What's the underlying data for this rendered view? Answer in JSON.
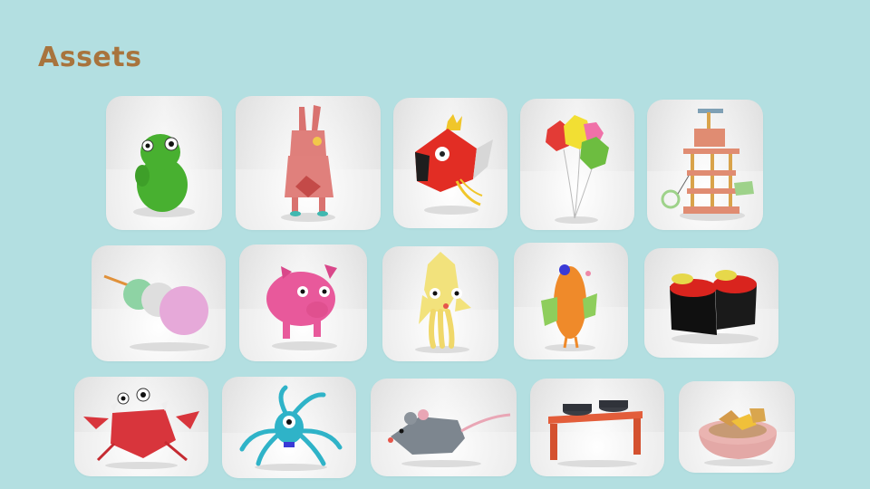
{
  "page": {
    "title": "Assets"
  },
  "assets": [
    {
      "icon": "green-creature-icon"
    },
    {
      "icon": "pink-bunny-icon"
    },
    {
      "icon": "red-fish-icon"
    },
    {
      "icon": "balloons-icon"
    },
    {
      "icon": "cat-tower-icon"
    },
    {
      "icon": "dango-skewer-icon"
    },
    {
      "icon": "pink-pig-icon"
    },
    {
      "icon": "yellow-squid-icon"
    },
    {
      "icon": "orange-bird-icon"
    },
    {
      "icon": "sushi-icon"
    },
    {
      "icon": "red-crab-icon"
    },
    {
      "icon": "teal-octopus-icon"
    },
    {
      "icon": "gray-mouse-icon"
    },
    {
      "icon": "pet-bowl-stand-icon"
    },
    {
      "icon": "pet-food-bowl-icon"
    }
  ]
}
